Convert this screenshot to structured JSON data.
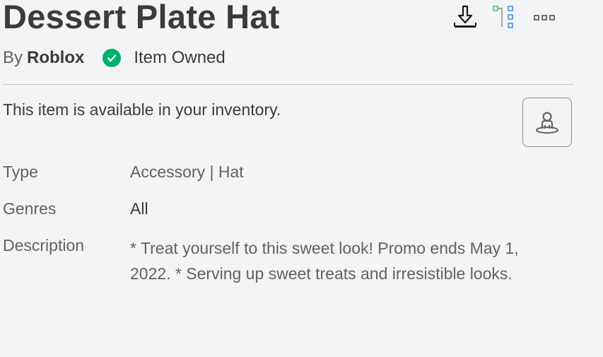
{
  "item": {
    "title": "Dessert Plate Hat",
    "by_label": "By",
    "creator": "Roblox",
    "owned_label": "Item Owned",
    "availability": "This item is available in your inventory."
  },
  "toolbar": {
    "download_icon": "download-icon",
    "hierarchy_icon": "hierarchy-icon",
    "more_icon": "more-options-icon"
  },
  "details": {
    "type_label": "Type",
    "type_value": "Accessory | Hat",
    "genres_label": "Genres",
    "genres_value": "All",
    "description_label": "Description",
    "description_value": "* Treat yourself to this sweet look! Promo ends May 1, 2022. * Serving up sweet treats and irresistible looks."
  },
  "colors": {
    "background": "#f2f4f5",
    "text_primary": "#393b3d",
    "text_secondary": "#606162",
    "owned_green": "#00b06f",
    "hierarchy_green": "#5dc78a",
    "hierarchy_blue": "#5b9be3"
  }
}
